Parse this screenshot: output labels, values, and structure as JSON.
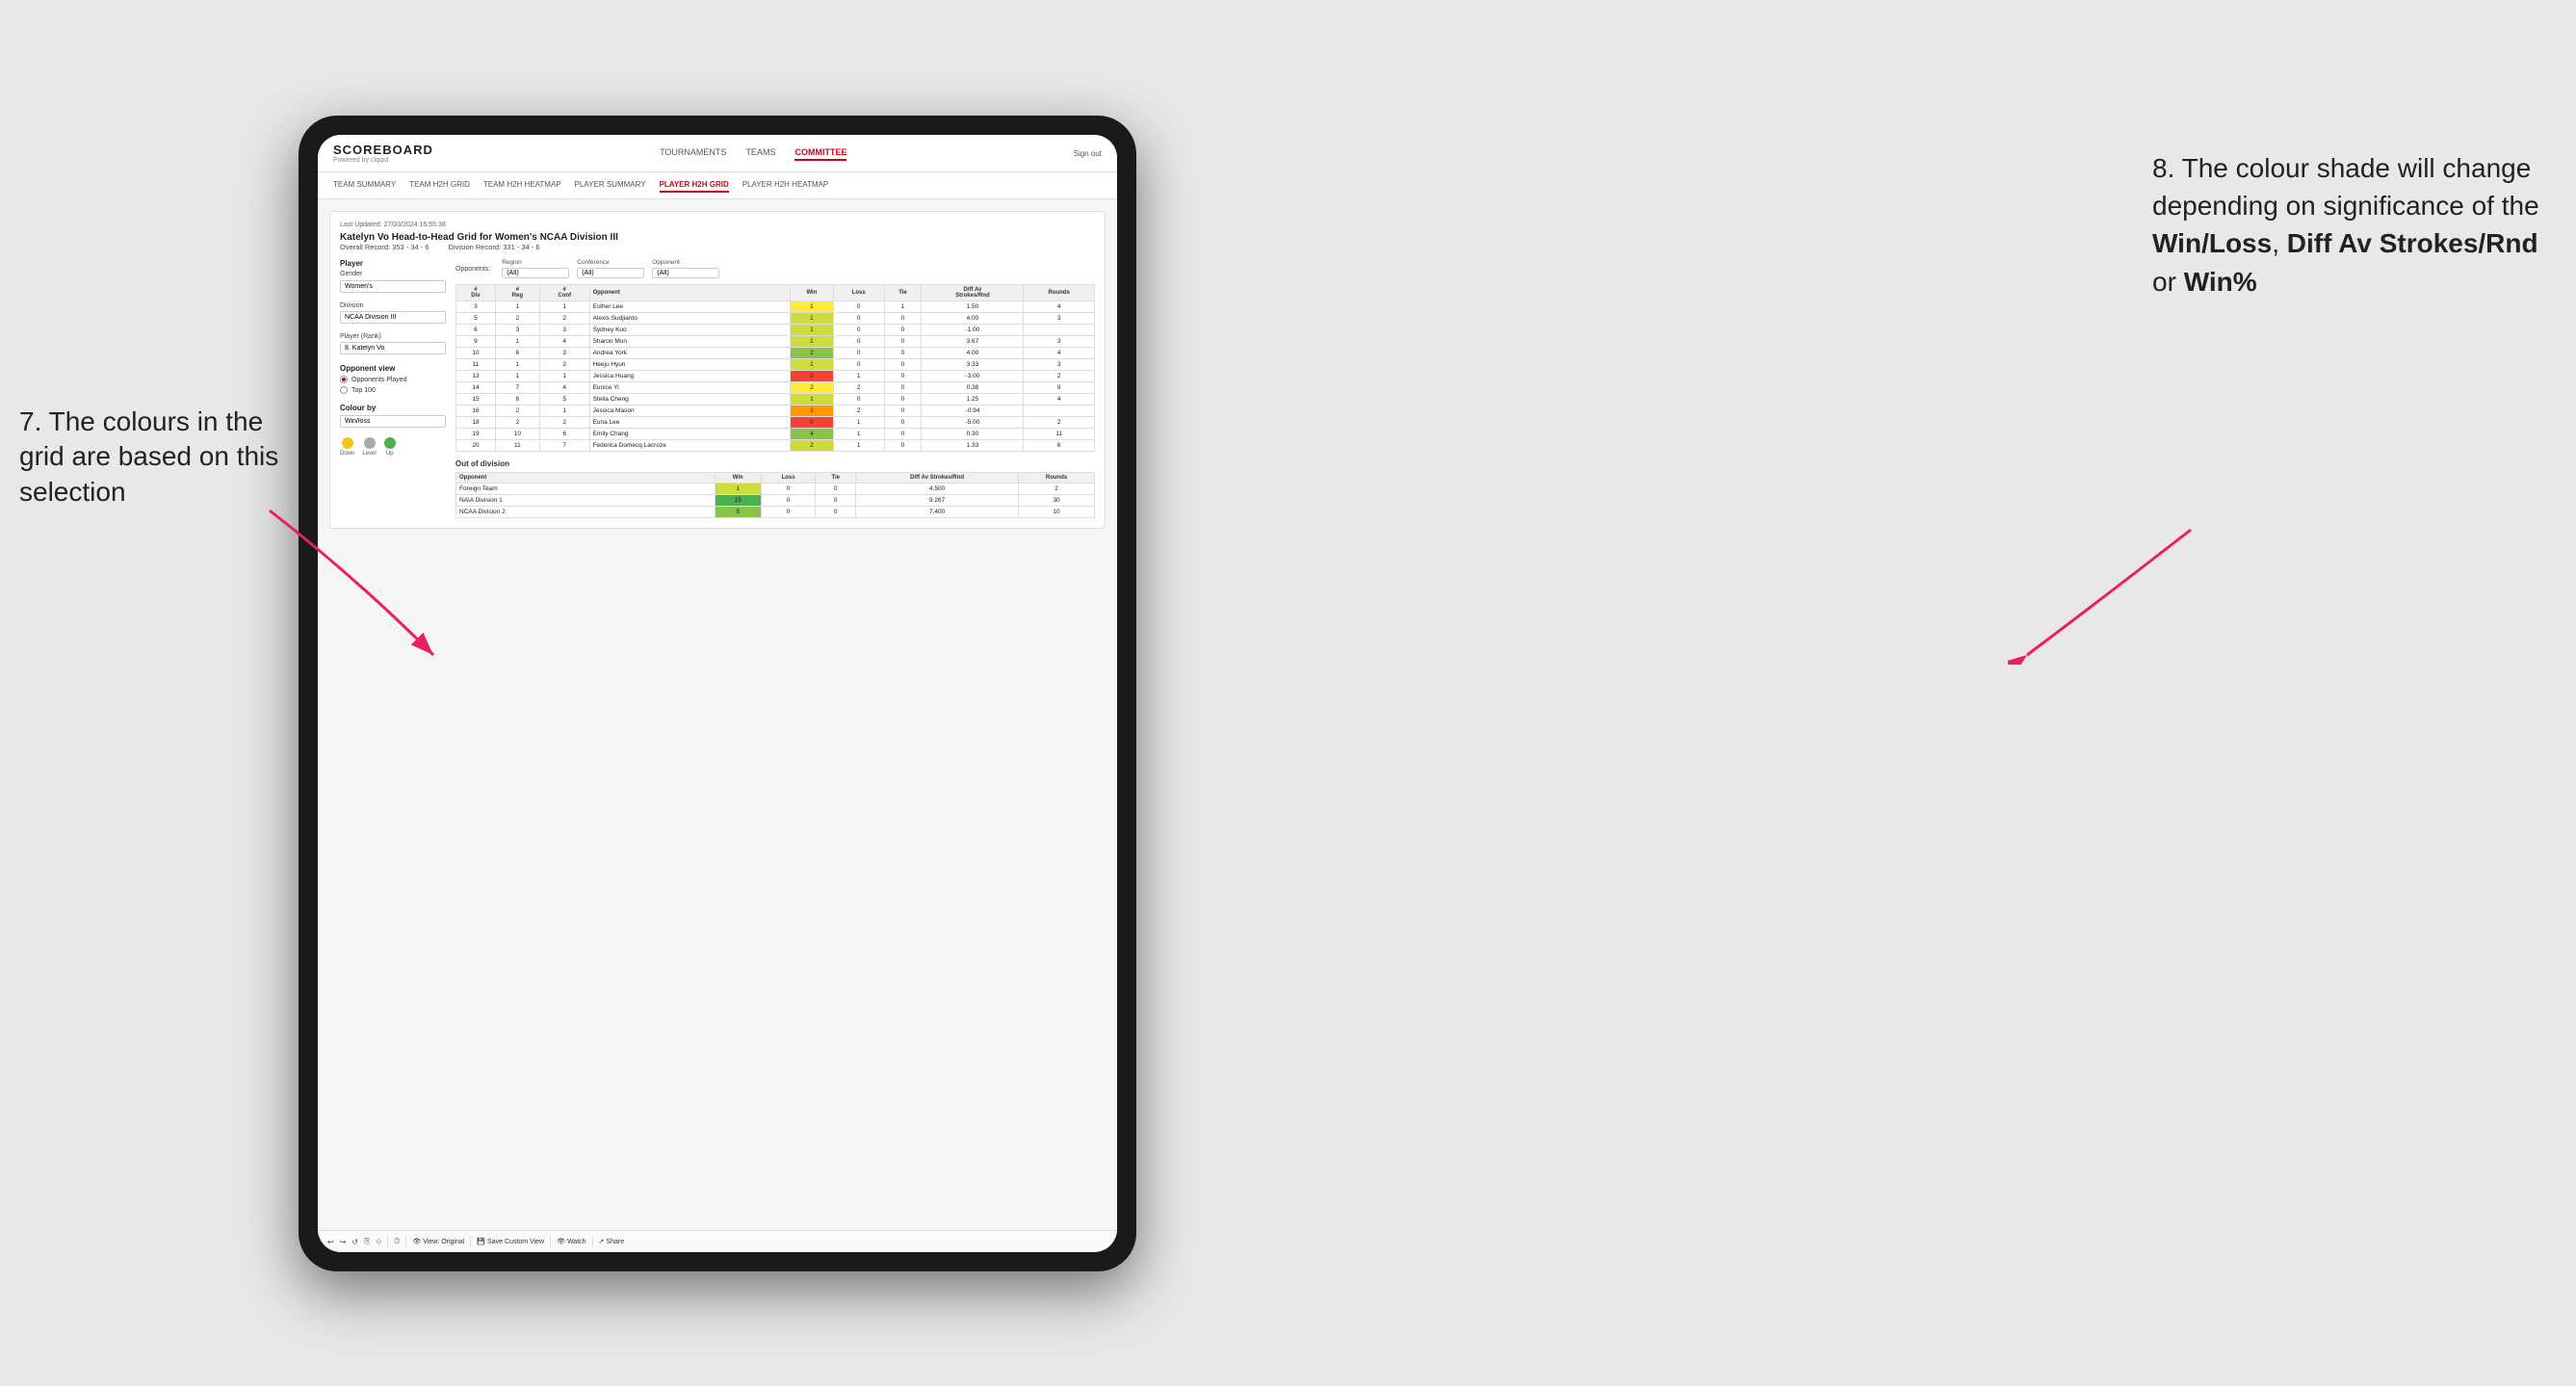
{
  "annotations": {
    "left_text": "7. The colours in the grid are based on this selection",
    "right_text_1": "8. The colour shade will change depending on significance of the ",
    "right_bold_1": "Win/Loss",
    "right_text_2": ", ",
    "right_bold_2": "Diff Av Strokes/Rnd",
    "right_text_3": " or ",
    "right_bold_3": "Win%"
  },
  "nav": {
    "logo": "SCOREBOARD",
    "logo_sub": "Powered by clippd",
    "links": [
      "TOURNAMENTS",
      "TEAMS",
      "COMMITTEE"
    ],
    "active_link": "COMMITTEE",
    "right": "Sign out"
  },
  "sub_nav": {
    "links": [
      "TEAM SUMMARY",
      "TEAM H2H GRID",
      "TEAM H2H HEATMAP",
      "PLAYER SUMMARY",
      "PLAYER H2H GRID",
      "PLAYER H2H HEATMAP"
    ],
    "active_link": "PLAYER H2H GRID"
  },
  "report": {
    "last_updated": "Last Updated: 27/03/2024 16:55:38",
    "title": "Katelyn Vo Head-to-Head Grid for Women's NCAA Division III",
    "overall_record": "Overall Record: 353 - 34 - 6",
    "division_record": "Division Record: 331 - 34 - 6",
    "left_panel": {
      "section_player": "Player",
      "gender_label": "Gender",
      "gender_value": "Women's",
      "division_label": "Division",
      "division_value": "NCAA Division III",
      "player_rank_label": "Player (Rank)",
      "player_rank_value": "8. Katelyn Vo",
      "opponent_view_label": "Opponent view",
      "opponent_view_options": [
        "Opponents Played",
        "Top 100"
      ],
      "opponent_view_selected": "Opponents Played",
      "colour_by_label": "Colour by",
      "colour_by_value": "Win/loss",
      "legend": {
        "down_label": "Down",
        "level_label": "Level",
        "up_label": "Up",
        "down_color": "#f5c518",
        "level_color": "#aaa",
        "up_color": "#4caf50"
      }
    },
    "filters": {
      "opponents_label": "Opponents:",
      "region_label": "Region",
      "region_value": "(All)",
      "conference_label": "Conference",
      "conference_value": "(All)",
      "opponent_label": "Opponent",
      "opponent_value": "(All)"
    },
    "table_headers": {
      "col1": "#\nDiv",
      "col2": "#\nReg",
      "col3": "#\nConf",
      "col4": "Opponent",
      "col5": "Win",
      "col6": "Loss",
      "col7": "Tie",
      "col8": "Diff Av\nStrokes/Rnd",
      "col9": "Rounds"
    },
    "rows": [
      {
        "div": "3",
        "reg": "1",
        "conf": "1",
        "opponent": "Esther Lee",
        "win": "1",
        "loss": "0",
        "tie": "1",
        "diff": "1.50",
        "rounds": "4",
        "win_color": "cell-yellow",
        "diff_color": "cell-white"
      },
      {
        "div": "5",
        "reg": "2",
        "conf": "2",
        "opponent": "Alexis Sudjianto",
        "win": "1",
        "loss": "0",
        "tie": "0",
        "diff": "4.00",
        "rounds": "3",
        "win_color": "cell-green-light",
        "diff_color": "cell-white"
      },
      {
        "div": "6",
        "reg": "3",
        "conf": "3",
        "opponent": "Sydney Kuo",
        "win": "1",
        "loss": "0",
        "tie": "0",
        "diff": "-1.00",
        "rounds": "",
        "win_color": "cell-green-light",
        "diff_color": "cell-yellow"
      },
      {
        "div": "9",
        "reg": "1",
        "conf": "4",
        "opponent": "Sharon Mun",
        "win": "1",
        "loss": "0",
        "tie": "0",
        "diff": "3.67",
        "rounds": "3",
        "win_color": "cell-green-light",
        "diff_color": "cell-white"
      },
      {
        "div": "10",
        "reg": "6",
        "conf": "3",
        "opponent": "Andrea York",
        "win": "2",
        "loss": "0",
        "tie": "0",
        "diff": "4.00",
        "rounds": "4",
        "win_color": "cell-green-med",
        "diff_color": "cell-white"
      },
      {
        "div": "11",
        "reg": "1",
        "conf": "2",
        "opponent": "Heeju Hyun",
        "win": "1",
        "loss": "0",
        "tie": "0",
        "diff": "3.33",
        "rounds": "3",
        "win_color": "cell-green-light",
        "diff_color": "cell-white"
      },
      {
        "div": "13",
        "reg": "1",
        "conf": "1",
        "opponent": "Jessica Huang",
        "win": "0",
        "loss": "1",
        "tie": "0",
        "diff": "-3.00",
        "rounds": "2",
        "win_color": "cell-red",
        "diff_color": "cell-white"
      },
      {
        "div": "14",
        "reg": "7",
        "conf": "4",
        "opponent": "Eunice Yi",
        "win": "2",
        "loss": "2",
        "tie": "0",
        "diff": "0.38",
        "rounds": "9",
        "win_color": "cell-yellow",
        "diff_color": "cell-white"
      },
      {
        "div": "15",
        "reg": "8",
        "conf": "5",
        "opponent": "Stella Cheng",
        "win": "1",
        "loss": "0",
        "tie": "0",
        "diff": "1.25",
        "rounds": "4",
        "win_color": "cell-green-light",
        "diff_color": "cell-white"
      },
      {
        "div": "16",
        "reg": "2",
        "conf": "1",
        "opponent": "Jessica Mason",
        "win": "1",
        "loss": "2",
        "tie": "0",
        "diff": "-0.94",
        "rounds": "",
        "win_color": "cell-orange",
        "diff_color": "cell-white"
      },
      {
        "div": "18",
        "reg": "2",
        "conf": "2",
        "opponent": "Euna Lee",
        "win": "0",
        "loss": "1",
        "tie": "0",
        "diff": "-5.00",
        "rounds": "2",
        "win_color": "cell-red",
        "diff_color": "cell-white"
      },
      {
        "div": "19",
        "reg": "10",
        "conf": "6",
        "opponent": "Emily Chang",
        "win": "4",
        "loss": "1",
        "tie": "0",
        "diff": "0.30",
        "rounds": "11",
        "win_color": "cell-green-med",
        "diff_color": "cell-white"
      },
      {
        "div": "20",
        "reg": "11",
        "conf": "7",
        "opponent": "Federica Domecq Lacroze",
        "win": "2",
        "loss": "1",
        "tie": "0",
        "diff": "1.33",
        "rounds": "6",
        "win_color": "cell-green-light",
        "diff_color": "cell-white"
      }
    ],
    "out_of_division_title": "Out of division",
    "out_of_division_rows": [
      {
        "opponent": "Foreign Team",
        "win": "1",
        "loss": "0",
        "tie": "0",
        "diff": "4.500",
        "rounds": "2",
        "win_color": "cell-green-light"
      },
      {
        "opponent": "NAIA Division 1",
        "win": "15",
        "loss": "0",
        "tie": "0",
        "diff": "9.267",
        "rounds": "30",
        "win_color": "cell-green-dark"
      },
      {
        "opponent": "NCAA Division 2",
        "win": "5",
        "loss": "0",
        "tie": "0",
        "diff": "7.400",
        "rounds": "10",
        "win_color": "cell-green-med"
      }
    ]
  },
  "toolbar": {
    "view_original": "View: Original",
    "save_custom": "Save Custom View",
    "watch": "Watch",
    "share": "Share"
  }
}
